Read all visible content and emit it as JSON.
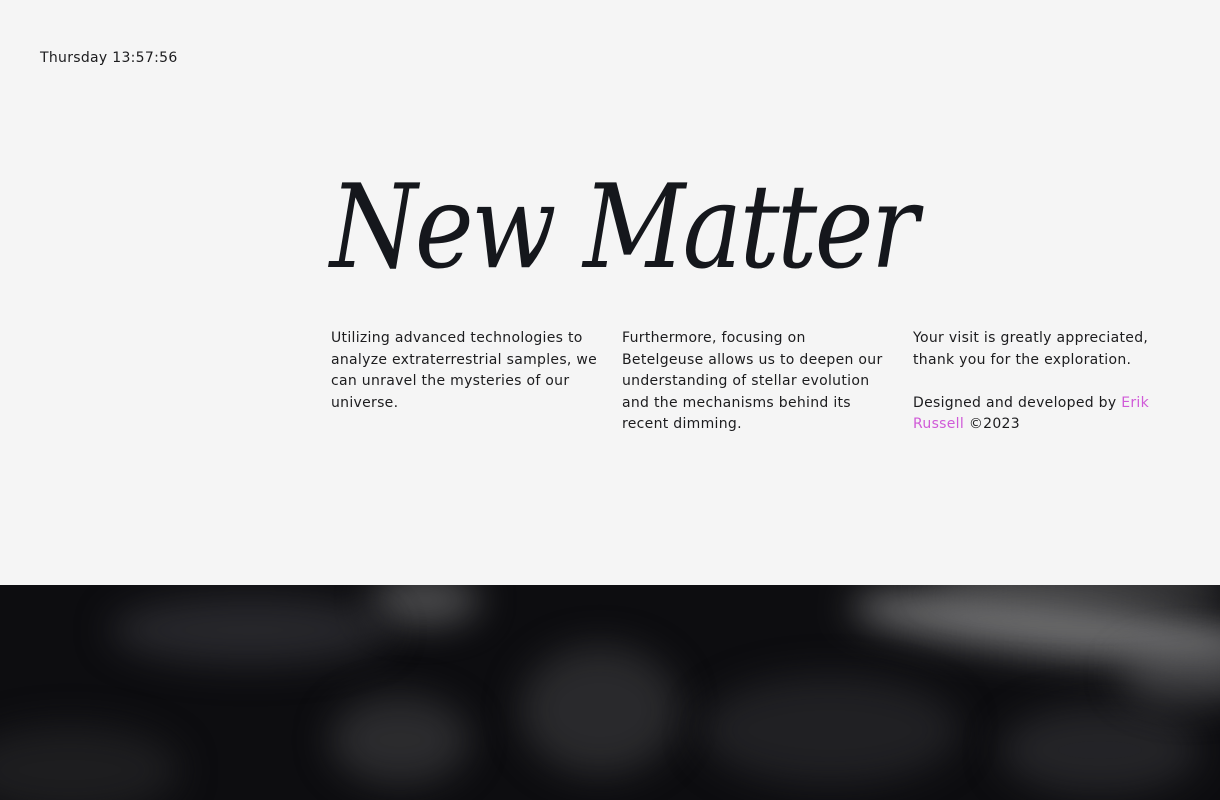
{
  "header": {
    "clock": "Thursday 13:57:56"
  },
  "hero": {
    "title": "New Matter"
  },
  "columns": {
    "col1": "Utilizing advanced technologies to analyze extraterrestrial samples, we can unravel the mysteries of our universe.",
    "col2": "Furthermore, focusing on Betelgeuse allows us to deepen our understanding of stellar evolution and the mechanisms behind its recent dimming.",
    "col3_thanks": "Your visit is greatly appreciated, thank you for the exploration.",
    "credit_prefix": "Designed and developed by",
    "credit_name": "Erik Russell",
    "credit_suffix": "©2023"
  },
  "colors": {
    "background": "#f5f5f5",
    "text": "#18181b",
    "accent_link": "#d05ad8",
    "dark_band": "#0d0d10"
  }
}
